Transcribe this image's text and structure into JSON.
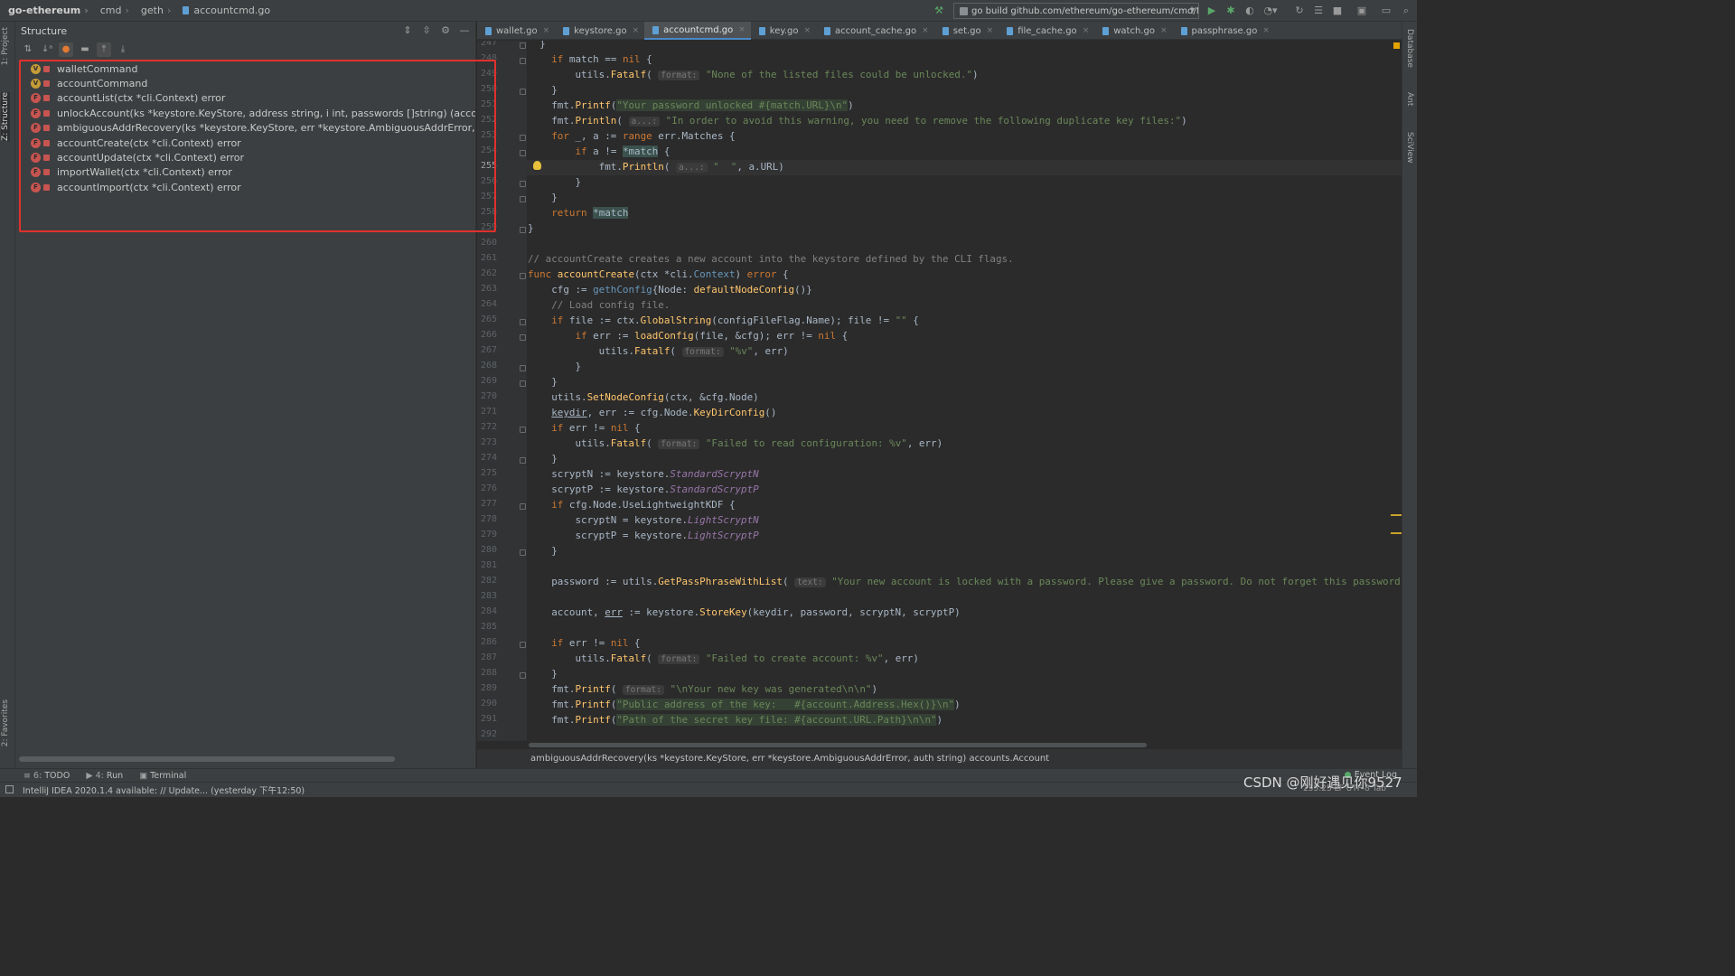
{
  "navbar": {
    "crumbs": [
      "go-ethereum",
      "cmd",
      "geth",
      "accountcmd.go"
    ],
    "run_config": "go build github.com/ethereum/go-ethereum/cmd/faucet"
  },
  "structure": {
    "title": "Structure",
    "items": [
      {
        "kind": "V",
        "label": "walletCommand"
      },
      {
        "kind": "V",
        "label": "accountCommand"
      },
      {
        "kind": "F",
        "label": "accountList(ctx *cli.Context) error"
      },
      {
        "kind": "F",
        "label": "unlockAccount(ks *keystore.KeyStore, address string, i int, passwords []string) (accounts.Acc"
      },
      {
        "kind": "F",
        "label": "ambiguousAddrRecovery(ks *keystore.KeyStore, err *keystore.AmbiguousAddrError, auth strin"
      },
      {
        "kind": "F",
        "label": "accountCreate(ctx *cli.Context) error"
      },
      {
        "kind": "F",
        "label": "accountUpdate(ctx *cli.Context) error"
      },
      {
        "kind": "F",
        "label": "importWallet(ctx *cli.Context) error"
      },
      {
        "kind": "F",
        "label": "accountImport(ctx *cli.Context) error"
      }
    ]
  },
  "tabs": [
    {
      "label": "wallet.go",
      "active": false
    },
    {
      "label": "keystore.go",
      "active": false
    },
    {
      "label": "accountcmd.go",
      "active": true
    },
    {
      "label": "key.go",
      "active": false
    },
    {
      "label": "account_cache.go",
      "active": false
    },
    {
      "label": "set.go",
      "active": false
    },
    {
      "label": "file_cache.go",
      "active": false
    },
    {
      "label": "watch.go",
      "active": false
    },
    {
      "label": "passphrase.go",
      "active": false
    }
  ],
  "editor": {
    "current_line": 255,
    "line_numbers": [
      "247",
      "248",
      "249",
      "250",
      "251",
      "252",
      "253",
      "254",
      "255",
      "256",
      "257",
      "258",
      "259",
      "260",
      "261",
      "262",
      "263",
      "264",
      "265",
      "266",
      "267",
      "268",
      "269",
      "270",
      "271",
      "272",
      "273",
      "274",
      "275",
      "276",
      "277",
      "278",
      "279",
      "280",
      "281",
      "282",
      "283",
      "284",
      "285",
      "286",
      "287",
      "288",
      "289",
      "290",
      "291",
      "292"
    ],
    "hint_format": "format:",
    "hint_a": "a...:",
    "hint_text": "text:",
    "strings": {
      "s249": "\"None of the listed files could be unlocked.\"",
      "s251": "\"Your password unlocked #{match.URL}\\n\"",
      "s252": "\"In order to avoid this warning, you need to remove the following duplicate key files:\"",
      "s255": "\"  \"",
      "c261": "// accountCreate creates a new account into the keystore defined by the CLI flags.",
      "c264": "// Load config file.",
      "s265": "\"\"",
      "s267": "\"%v\"",
      "s273": "\"Failed to read configuration: %v\"",
      "s282": "\"Your new account is locked with a password. Please give a password. Do not forget this password.\"",
      "s287": "\"Failed to create account: %v\"",
      "s289": "\"\\nYour new key was generated\\n\\n\"",
      "s290": "\"Public address of the key:   #{account.Address.Hex()}\\n\"",
      "s291": "\"Path of the secret key file: #{account.URL.Path}\\n\\n\""
    }
  },
  "breadcrumb_footer": "ambiguousAddrRecovery(ks *keystore.KeyStore, err *keystore.AmbiguousAddrError, auth string) accounts.Account",
  "tool_windows": [
    {
      "prefix": "≡ 6:",
      "label": "TODO"
    },
    {
      "prefix": "▶ 4:",
      "label": "Run"
    },
    {
      "prefix": "▣",
      "label": "Terminal"
    }
  ],
  "event_log": "Event Log",
  "left_strip": {
    "project": "1: Project",
    "structure": "Z: Structure",
    "favorites": "2: Favorites"
  },
  "right_strip": {
    "database": "Database",
    "ant": "Ant",
    "sciview": "SciView"
  },
  "status": {
    "message": "IntelliJ IDEA 2020.1.4 available: // Update... (yesterday 下午12:50)",
    "position": "255:25  LF  UTF-8  Tab"
  },
  "watermark": "CSDN @刚好遇见你9527"
}
